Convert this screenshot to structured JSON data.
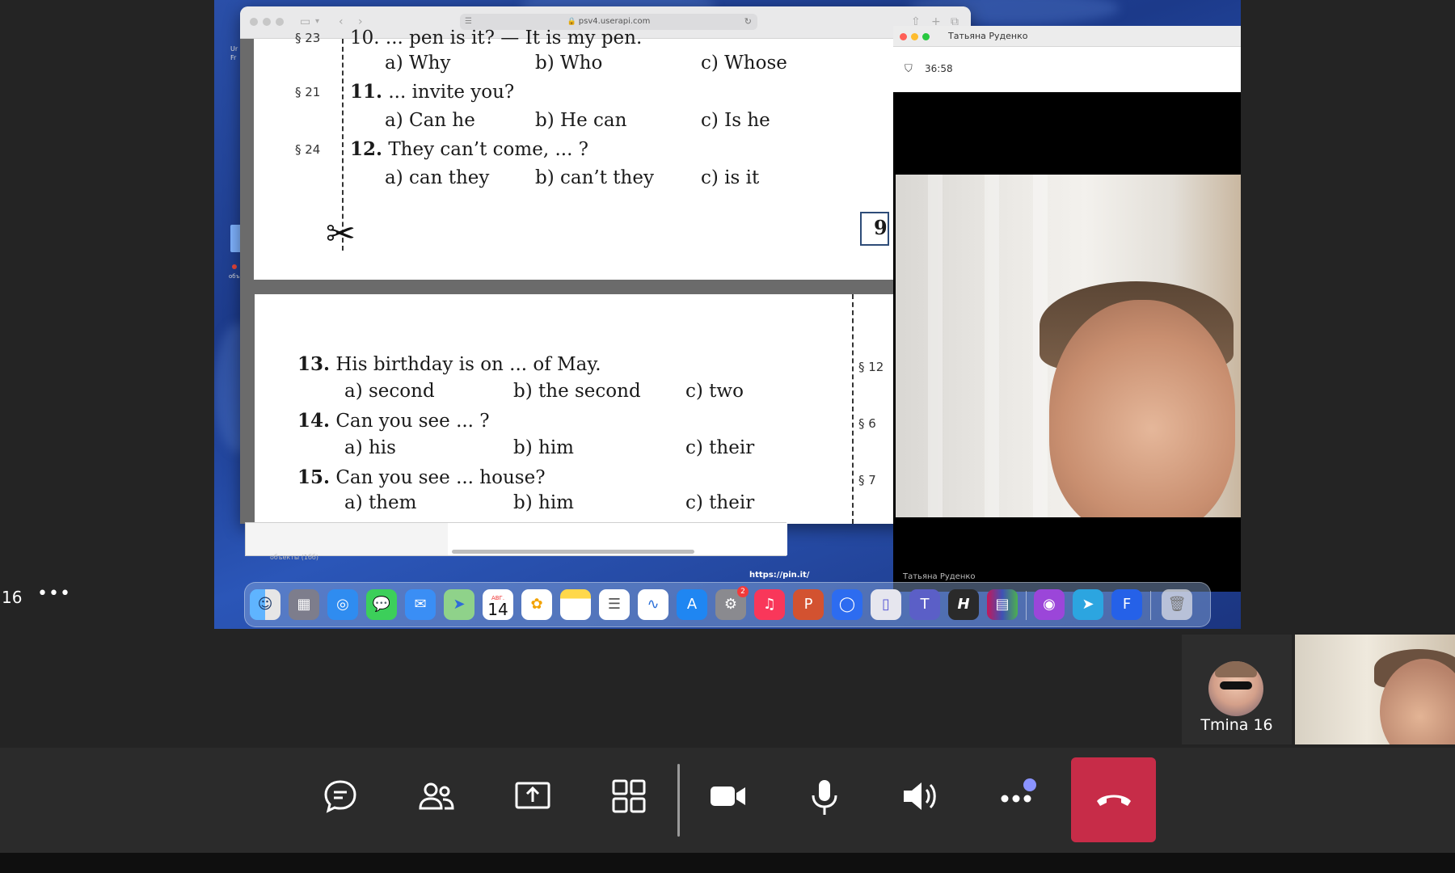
{
  "browser": {
    "url": "psv4.userapi.com"
  },
  "worksheet": {
    "top": {
      "partial_question": "10. ... pen is it? — It is my pen.",
      "partial_section": "§ 23",
      "q10_options": [
        "a) Why",
        "b) Who",
        "c) Whose"
      ],
      "q11": {
        "section": "§ 21",
        "num": "11.",
        "text": "... invite you?",
        "options": [
          "a) Can he",
          "b) He can",
          "c) Is he"
        ]
      },
      "q12": {
        "section": "§ 24",
        "num": "12.",
        "text": "They can’t come, ... ?",
        "options": [
          "a) can they",
          "b) can’t they",
          "c) is it"
        ]
      },
      "page_number": "9"
    },
    "bottom": {
      "q13": {
        "section": "§ 12",
        "num": "13.",
        "text": "His birthday is on ... of May.",
        "options": [
          "a) second",
          "b) the second",
          "c) two"
        ]
      },
      "q14": {
        "section": "§ 6",
        "num": "14.",
        "text": "Can you see ... ?",
        "options": [
          "a) his",
          "b) him",
          "c) their"
        ]
      },
      "q15": {
        "section": "§ 7",
        "num": "15.",
        "text": "Can you see ... house?",
        "options": [
          "a) them",
          "b) him",
          "c) their"
        ]
      }
    }
  },
  "underwin": {
    "tiny_text": "объекты (1бб)"
  },
  "pin_url": "https://pin.it/",
  "video_window": {
    "title": "Татьяна Руденко",
    "timer": "36:58",
    "name_overlay": "Татьяна Руденко"
  },
  "desktop_left": {
    "label_1": "Ur",
    "label_2": "Fr",
    "obj": "объ"
  },
  "dock": {
    "calendar_day": "14",
    "calendar_month": "АВГ.",
    "settings_badge": "2",
    "icons": [
      "finder-icon",
      "launchpad-icon",
      "safari-icon",
      "messages-icon",
      "mail-icon",
      "maps-icon",
      "calendar-icon",
      "photos-icon",
      "notes-icon",
      "reminders-icon",
      "freeform-icon",
      "app-store-icon",
      "system-settings-icon",
      "music-icon",
      "powerpoint-icon",
      "zoom-icon",
      "phone-mirror-icon",
      "teams-icon",
      "h-app-icon",
      "winrar-icon",
      "podcasts-icon",
      "telegram-icon",
      "flow-icon",
      "trash-icon"
    ]
  },
  "call": {
    "left_number": "16",
    "left_more": "•••",
    "self_name": "Tmina 16"
  },
  "colors": {
    "hangup": "#c72c48",
    "notif": "#8a93ff",
    "toolbar": "#2b2b2b"
  }
}
